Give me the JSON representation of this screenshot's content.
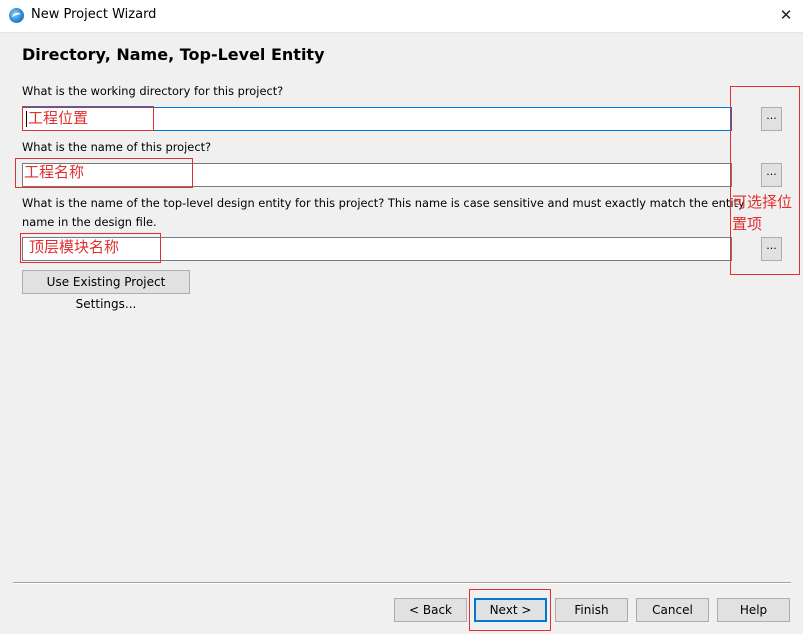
{
  "window": {
    "title": "New Project Wizard",
    "close_glyph": "✕",
    "app_icon": "quartus-globe-icon"
  },
  "page": {
    "title": "Directory, Name, Top-Level Entity"
  },
  "fields": {
    "directory_prompt": "What is the working directory for this project?",
    "directory_value": "",
    "name_prompt": "What is the name of this project?",
    "name_value": "",
    "entity_prompt": "What is the name of the top-level design entity for this project? This name is case sensitive and must exactly match the entity name in the design file.",
    "entity_value": "",
    "browse_label": "..."
  },
  "actions": {
    "use_existing": "Use Existing Project Settings...",
    "back": "< Back",
    "next": "Next >",
    "finish": "Finish",
    "cancel": "Cancel",
    "help": "Help"
  },
  "annotations": {
    "directory": "工程位置",
    "name": "工程名称",
    "entity": "顶层模块名称",
    "browse": "可选择位置项",
    "color": "#e03030"
  }
}
